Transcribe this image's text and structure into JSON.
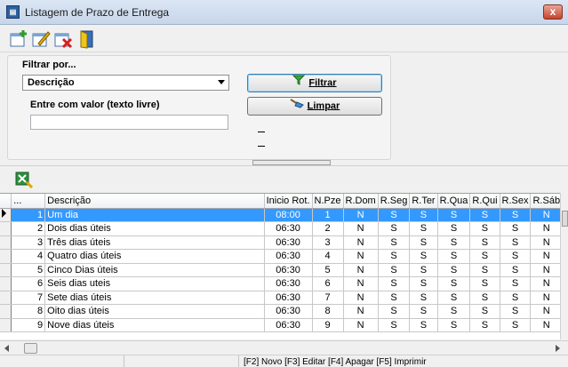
{
  "window": {
    "title": "Listagem de Prazo de Entrega",
    "close_label": "x"
  },
  "filter": {
    "section_label": "Filtrar por...",
    "selected_field": "Descrição",
    "value_label": "Entre com valor (texto livre)",
    "value": "",
    "filter_button": "Filtrar",
    "clear_button": "Limpar"
  },
  "grid": {
    "columns": [
      "...",
      "Descrição",
      "Inicio Rot.",
      "N.Pze",
      "R.Dom",
      "R.Seg",
      "R.Ter",
      "R.Qua",
      "R.Qui",
      "R.Sex",
      "R.Sáb"
    ],
    "rows": [
      {
        "id": "1",
        "descricao": "Um dia",
        "inicio": "08:00",
        "npze": "1",
        "dom": "N",
        "seg": "S",
        "ter": "S",
        "qua": "S",
        "qui": "S",
        "sex": "S",
        "sab": "N"
      },
      {
        "id": "2",
        "descricao": "Dois dias úteis",
        "inicio": "06:30",
        "npze": "2",
        "dom": "N",
        "seg": "S",
        "ter": "S",
        "qua": "S",
        "qui": "S",
        "sex": "S",
        "sab": "N"
      },
      {
        "id": "3",
        "descricao": "Três dias úteis",
        "inicio": "06:30",
        "npze": "3",
        "dom": "N",
        "seg": "S",
        "ter": "S",
        "qua": "S",
        "qui": "S",
        "sex": "S",
        "sab": "N"
      },
      {
        "id": "4",
        "descricao": "Quatro dias úteis",
        "inicio": "06:30",
        "npze": "4",
        "dom": "N",
        "seg": "S",
        "ter": "S",
        "qua": "S",
        "qui": "S",
        "sex": "S",
        "sab": "N"
      },
      {
        "id": "5",
        "descricao": "Cinco Dias úteis",
        "inicio": "06:30",
        "npze": "5",
        "dom": "N",
        "seg": "S",
        "ter": "S",
        "qua": "S",
        "qui": "S",
        "sex": "S",
        "sab": "N"
      },
      {
        "id": "6",
        "descricao": "Seis dias uteis",
        "inicio": "06:30",
        "npze": "6",
        "dom": "N",
        "seg": "S",
        "ter": "S",
        "qua": "S",
        "qui": "S",
        "sex": "S",
        "sab": "N"
      },
      {
        "id": "7",
        "descricao": "Sete dias úteis",
        "inicio": "06:30",
        "npze": "7",
        "dom": "N",
        "seg": "S",
        "ter": "S",
        "qua": "S",
        "qui": "S",
        "sex": "S",
        "sab": "N"
      },
      {
        "id": "8",
        "descricao": "Oito dias úteis",
        "inicio": "06:30",
        "npze": "8",
        "dom": "N",
        "seg": "S",
        "ter": "S",
        "qua": "S",
        "qui": "S",
        "sex": "S",
        "sab": "N"
      },
      {
        "id": "9",
        "descricao": "Nove dias úteis",
        "inicio": "06:30",
        "npze": "9",
        "dom": "N",
        "seg": "S",
        "ter": "S",
        "qua": "S",
        "qui": "S",
        "sex": "S",
        "sab": "N"
      }
    ]
  },
  "status": {
    "shortcuts": "[F2] Novo [F3] Editar [F4] Apagar [F5] Imprimir"
  },
  "colors": {
    "selection": "#3399ff",
    "title_bar": "#c7d6ea"
  }
}
